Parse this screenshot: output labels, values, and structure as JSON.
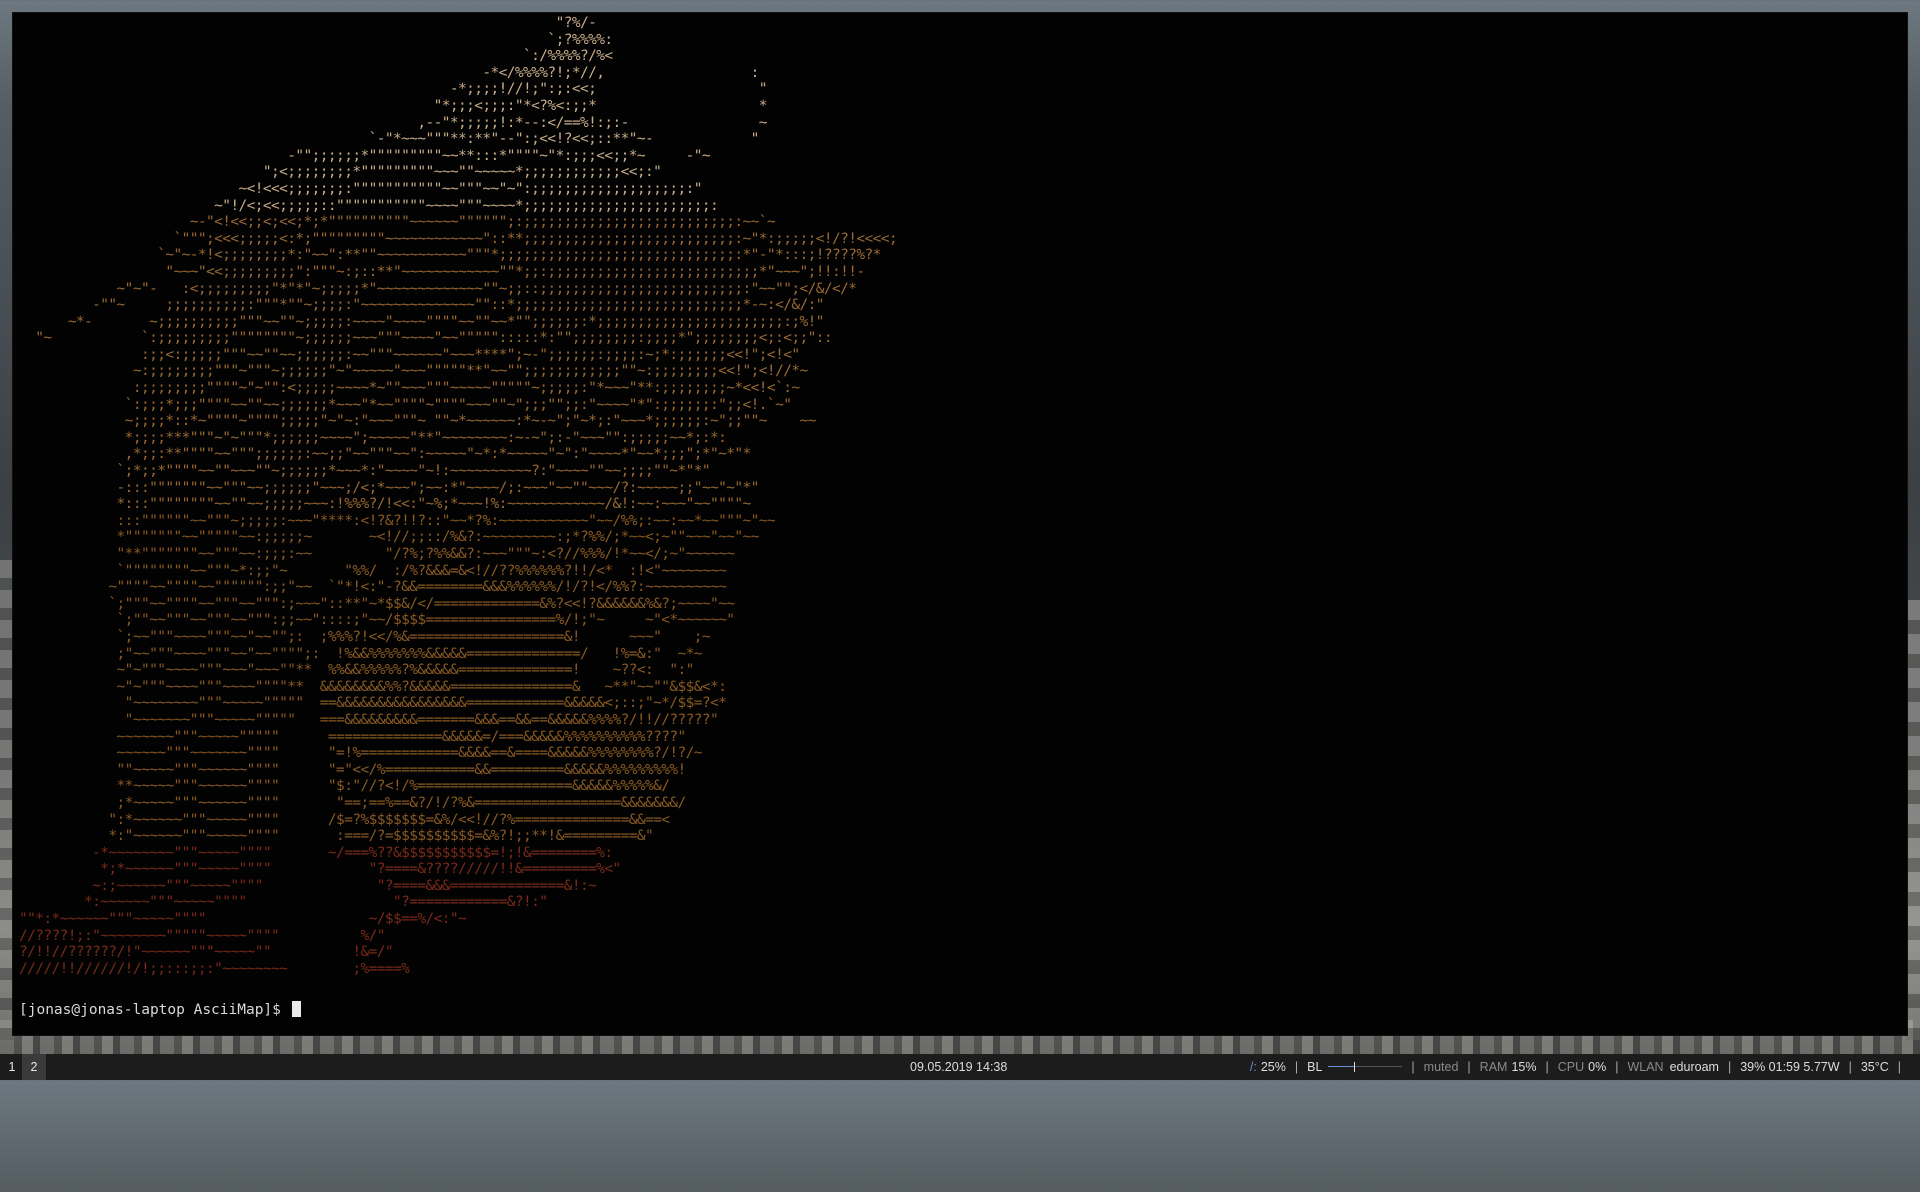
{
  "terminal": {
    "ascii_art_rows": [
      "                                                                  \"?%/-",
      "                                                                 `;?%%%%:",
      "                                                              `:/%%%%?/%<",
      "                                                         -*</%%%%?!;*//,                  :",
      "                                                     -*;;;;!//!;\":;:<<;                    \"",
      "                                                   \"*;;;<;;;:\"*<?%<:;;*                    *",
      "                                                 ,--\"*;;;;;!:*--:</==%!:;:-                ~",
      "                                           `-\"*~~~\"\"\"**:**\"--\":;<<!?<<;::**\"~-            \"",
      "                                 -\"\";;;;;;*\"\"\"\"\"\"\"\"\"~~**:::*\"\"\"\"~\"*:;;;<<;;*~     -\"~",
      "                              \";<;;;;;;;;*\"\"\"\"\"\"\"\"\"~~~\"\"~~~~~*;;;;;;;;;;;;<<;:\"",
      "                           ~<!<<<;;;;;;;:\"\"\"\"\"\"\"\"\"\"\"~~\"\"\"~~\"~\":;;;;;;;;;;;;;;;;;;;:\"",
      "                        ~\"!/<;<<;;;;;::\"\"\"\"\"\"\"\"\"\"\"~~~~\"\"\"~~~~*;;;;;;;;;;;;;;;;;;;;;;;:",
      "                     ~-\"<!<<;;<;<<;*;*\"\"\"\"\"\"\"\"\"\"~~~~~~\"\"\"\"\"\";:;;;;;;;;;;;;;;;;;;;;;;;;;;:~~`~",
      "                   `\"\"\";<<<;;;;;<:*;\"\"\"\"\"\"\"\"\"~~~~~~~~~~~~\"::**;;;;;;;;;;;;;;;;;;;;;;;;;;:~\"*:;;;;;<!/?!<<<<;",
      "                 `~\"~-*!<;;;;;;;;*:\"~~\":**\"\"~~~~~~~~~~~\"\"\"*;;;;;;;;;;;;;;;;;;;;;;;;;;;;;:*\"-\"*:::;!????%?*",
      "                  \"~~~\"<<;;;;;;;;;\":\"\"\"~:;::**\"~~~~~~~~~~~~\"\"*;;:;;;;;;;;;;;;;;;;;;;;;;;;;;*\"~~~\";!!:!!-",
      "            ~\"~\"-   :<;;;;;;;;;\"*\"*\"~;;;;;*\"~~~~~~~~~~~~~\"\"~;;::;;;;;;;;;;;;;;;;;;;;;;;;;:\"~~\"\";</&/</*",
      "         -\"\"~     ;;;;;;;;;;:\"\"\"*\"\"~;;;;:\"~~~~~~~~~~~~~~\"\"::*;;;;;;;;;;;;;;;;;;;;;;;;;;;;*-~:</&/:\"",
      "      ~*-       ~;;;;;;;;;;\"\"\"~~\"\"~;;;;;:~~~~\"~~~~\"\"\"\"~~\"\"~~*\"\";;;;;;:*;;;;;;;;;;;;;;;;;;;;;;;:;%!\"",
      "  \"~           `:;;;;;;;;;\"\"\"\"\"\"\"\"~;;;;;;~~~\"\"\"~~~~\"~~\"\"\"\"\":::::*:\"\";;;;;;;;:;;;;*\";;;;;;;;<;:<;;\"::",
      "               :;;<:;;;;;\"\"\"~~\"\"~~;;;;;;:~~\"\"\"~~~~~~\"~~~****\";~-\";;;;;;:;;;;:~;*:;;;;;;<<!\";<!<\"",
      "              ~:;;;;;;;;\"\"\"~\"\"\"~;;;;;;\"~\"~~~~~\"~~~\"\"\"\"\"**\"~~\"\";;;;;;;;;;;;\"\"~:;;;;;;;;<<!\";<!//*~",
      "              :;;;;;;;;\"\"\"\"~\"~\"\":<;;;;;~~~~*~\"\"~~~\"\"\"~~~~~\"\"\"\"\"~;;;;;:\"*~~~\"**:;;;;;;;;~*<<!<`:~",
      "             `:;;;*;;;\"\"\"\"~~\"\"~~;;;;;;*~~~\"*~~\"\"\"\"~\"\"\"\"~~~\"\"~\";;;\"\";;:\"~~~~\"*\":;;;;;;:\";;<!.`~\"",
      "             ~;;;;*::*~\"\"\"\"~\"\"\"\";;;;;\"~\"~:\"~~~\"\"\"~ \"\"~*~~~~~~:*~-~\";\"~*;:\"~~~*;;;;;;:~\";;\"\"~    ~~",
      "             *;;;;***\"\"\"~\"~\"\"\"*;;;;;;~~~~\";~~~~~\"**\"~~~~~~~~:~-~\";:-\"~~~\"\":;;;;;~~*;:*:",
      "             ,*;;:**\"\"\"\"~~\"\"\";;;;;;:~~;;\"~~\"\"\"~~\":~~~~~\"~*:*~~~~~\"~\":\"~~~~*\"~~*;;;\";*\"~*\"*",
      "            `;*;;*\"\"\"\"~~\"\"~~~\"\"~;;;;;;*~~~*:\"~~~~\"~!:~~~~~~~~~~?:\"~~~~\"\"~~;;;;\"\"~*\"*\"",
      "            -:::\"\"\"\"\"\"\"~~\"\"\"~~;;;;;;\"~~~;/<;*~~~\";~~:*\"~~~~/;:~~~\"~~\"\"~~~/?:~~~~~;;\"~~\"~\"*\"",
      "            *:::\"\"\"\"\"\"\"\"~~\"\"~~;;;;;~~~:!%%%?/!<<:\"~%;*~~~!%:~~~~~~~~~~~~/&!:~~:~~~\"~~\"\"\"\"~",
      "            :::\"\"\"\"\"\"~~\"\"\"~;;;;;:~~~\"****:<!?&?!!?::\"~~*?%:~~~~~~~~~~~\"~~/%%;:~~:~~*~~\"\"\"~\"~~",
      "            *\"\"\"\"\"\"\"~~\"\"\"\"\"~~:;;;;;~       ~<!//;;::/%&?:~~~~~~~~~:;*?%%/;*~~<;~\"\"~~~\"~~\"~~",
      "            \"**\"\"\"\"\"\"\"~~\"\"\"~~:;;;:~~         \"/?%;?%%&&?:~~~\"\"\"~:<?//%%%/!*~~</;~\"~~~~~~",
      "            `\"\"\"\"\"\"\"\"~~\"\"\"~*:;;\"~       \"%%/  :/%?&&&=&<!//??%%%%%%?!!/<*  :!<\"~~~~~~~~",
      "           ~\"\"\"\"~~\"\"\"\"~~\"\"\"\"\"\":;;\"~~  `\"*!<:\"-?&&========&&&%%%%%%/!/?!</%%?:~~~~~~~~~~",
      "           `;\"\"\"~~\"\"\"\"~~\"\"\"~~\"\"\":;~~~\"::**\"~*$$&/</=============&%?<<!?&&&&&&%&?;~~~~\"~~",
      "            `;\"\"~~\"\"\"~~\"\"\"~~\"\"\":;;~~\"::::;\"~~/$$$$================%/!;\"~     ~\"<*~~~~~~\"",
      "            `;~~\"\"\"~~~~\"\"\"~~\"~~\"\";:  ;%%%?!<</%&===================&!      ~~~\"    ;~",
      "            ;\"~~\"\"\"~~~~\"\"\"~~\"~~\"\"\"\";:  !%&&%%%%%%%&&&&&==============/   !%=&:\"  ~*~",
      "            ~\"~\"\"\"~~~~\"\"\"~~~\"~~~\"\"**  %%&&%%%%%?%&&&&&==============!    ~??<:  \":\"",
      "            ~\"~\"\"\"~~~~\"\"\"~~~~\"\"\"\"**  &&&&&&&&%%?&&&&&===============&   ~**\"~~\"\"&$$&<*:",
      "             \"~~~~~~~~\"\"\"~~~~~\"\"\"\"\"  ==&&&&&&&&&&&&&&&&============&&&&&<;::;\"~*/$$=?<*",
      "             \"~~~~~~~\"\"\"~~~~~\"\"\"\"\"   ===&&&&&&&&&=======&&&==&&==&&&&&%%%%?/!!//?????\"",
      "            ~~~~~~~\"\"\"~~~~~\"\"\"\"\"      ==============&&&&&=/===&&&&&%%%%%%%%%%????\"",
      "            ~~~~~~\"\"\"~~~~~~~\"\"\"\"      \"=!%============&&&&==&====&&&&&%%%%%%%%?/!?/~",
      "            \"\"~~~~~\"\"\"~~~~~~\"\"\"\"      \"=\"<</%===========&&=========&&&&&%%%%%%%%%!",
      "            **~~~~~\"\"\"~~~~~~\"\"\"\"      \"$:\"//?<!/%===================&&&&&%%%%%&/",
      "            ;*~~~~~\"\"\"~~~~~~\"\"\"\"       \"==;==%==&?/!/?%&==================&&&&&&&/",
      "           \":*~~~~~~\"\"\"~~~~~\"\"\"\"      /$=?%$$$$$$$=&%/<<!//?%==============&&==<",
      "           *:\"~~~~~~\"\"\"~~~~~\"\"\"\"       :===/?=$$$$$$$$$$=&%?!;;**!&=========&\"",
      "         -*~~~~~~~~\"\"\"~~~~~\"\"\"\"       ~/===%??&$$$$$$$$$$$=!;!&========%:",
      "          *;*~~~~~~\"\"\"~~~~~\"\"\"\"            \"?====&????/////!!&=========%<\"",
      "         ~:;~~~~~~\"\"\"~~~~~\"\"\"\"              \"?====&&&==============&!:~",
      "        *:~~~~~~\"\"\"~~~~~\"\"\"\"                  \"?============&?!:\"",
      "\"\"*:*~~~~~~\"\"\"~~~~~\"\"\"\"                    ~/$$==%/<:\"~",
      "//????!;:\"~~~~~~~~\"\"\"\"\"~~~~~\"\"\"\"          %/\"",
      "?/!!//??????/!\"~~~~~~\"\"\"~~~~~\"\"          !&=/\"",
      "/////!!//////!/!;;:::;;:\"~~~~~~~~        ;%====%"
    ],
    "prompt": "[jonas@jonas-laptop AsciiMap]$ "
  },
  "status_bar": {
    "workspaces": [
      "1",
      "2"
    ],
    "datetime": "09.05.2019 14:38",
    "disk": {
      "label": "/:",
      "value": "25%"
    },
    "backlight": {
      "label": "BL",
      "level": 0.35
    },
    "volume": "muted",
    "ram": {
      "label": "RAM",
      "value": "15%"
    },
    "cpu": {
      "label": "CPU",
      "value": "0%"
    },
    "wlan": {
      "label": "WLAN",
      "value": "eduroam"
    },
    "battery": "39% 01:59 5.77W",
    "temperature": "35°C",
    "separator": "|",
    "colors": {
      "bar_bg": "#1c1c1c",
      "accent": "#6b8fd8",
      "terminal_bg": "#020202",
      "ascii": "#8a5a22"
    }
  }
}
